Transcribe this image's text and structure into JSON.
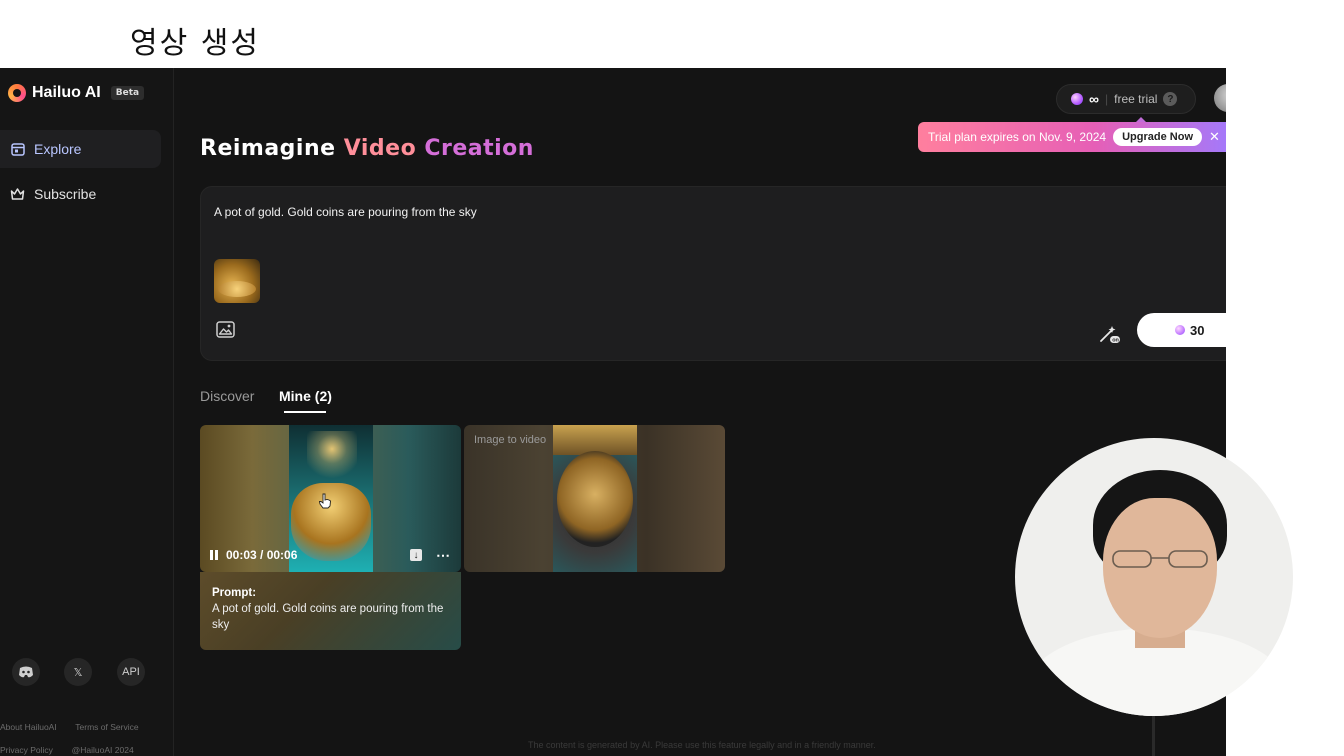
{
  "overlay": {
    "title": "영상 생성"
  },
  "sidebar": {
    "brand": "Hailuo AI",
    "beta": "Beta",
    "items": [
      {
        "label": "Explore",
        "icon": "calendar-icon",
        "active": true
      },
      {
        "label": "Subscribe",
        "icon": "crown-icon",
        "active": false
      }
    ],
    "social": [
      {
        "icon": "discord-icon"
      },
      {
        "icon": "x-icon",
        "label": "𝕏"
      },
      {
        "icon": "api-icon",
        "label": "API"
      }
    ],
    "footer": {
      "about": "About HailuoAI",
      "terms": "Terms of Service",
      "privacy": "Privacy Policy",
      "copyright": "@HailuoAI 2024"
    }
  },
  "header": {
    "credits_symbol": "∞",
    "plan": "free trial",
    "help": "?",
    "banner_text": "Trial plan expires on Nov. 9, 2024",
    "upgrade_label": "Upgrade Now",
    "close": "✕"
  },
  "headline": {
    "part1": "Reimagine",
    "part2": "Video",
    "part3": "Creation"
  },
  "prompt": {
    "text": "A pot of gold. Gold coins are pouring from the sky",
    "cost": "30"
  },
  "tabs": [
    {
      "label": "Discover",
      "active": false
    },
    {
      "label": "Mine (2)",
      "active": true
    }
  ],
  "videos": [
    {
      "time": "00:03 / 00:06",
      "prompt_label": "Prompt:",
      "prompt_text": "A pot of gold. Gold coins are pouring from the sky"
    },
    {
      "label": "Image to video"
    }
  ],
  "disclaimer": "The content is generated by AI. Please use this feature legally and in a friendly manner.",
  "colors": {
    "accent_video": "#ff8f9a",
    "accent_creation": "#d46ed8",
    "explore": "#b9c6ff"
  }
}
